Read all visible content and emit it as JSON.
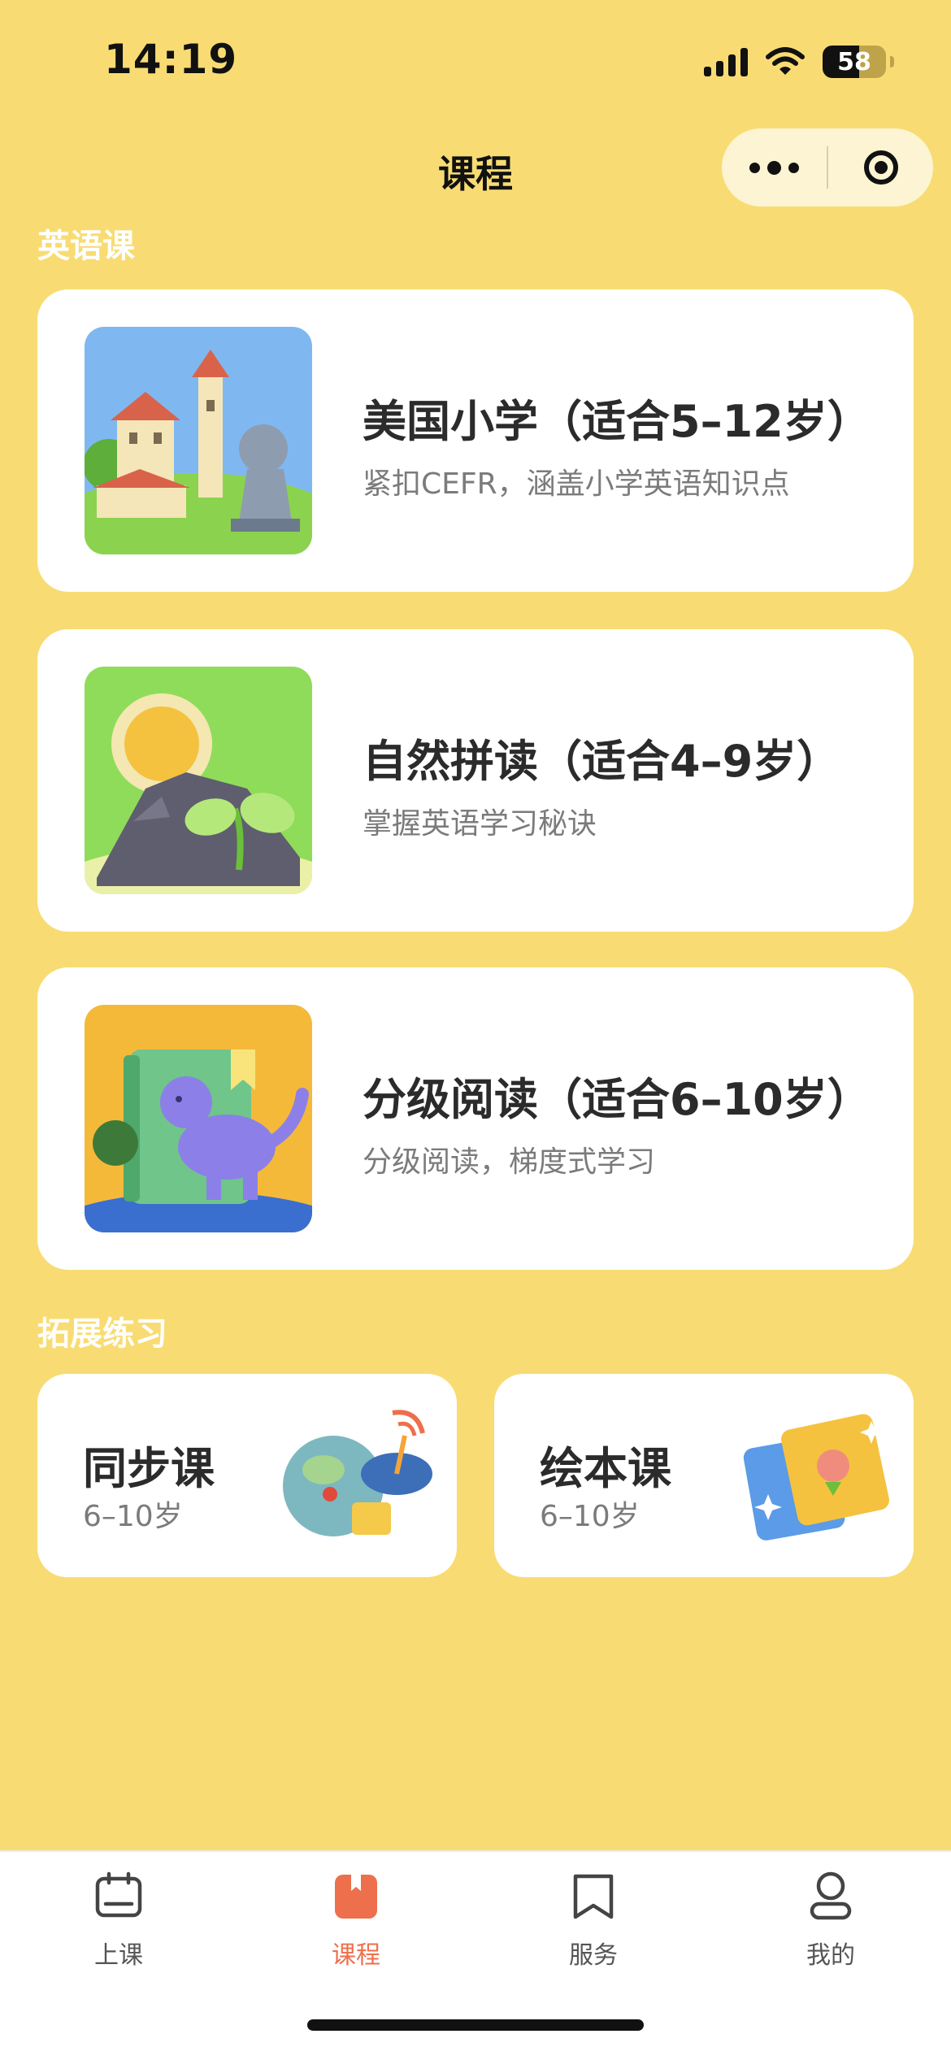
{
  "status": {
    "time": "14:19",
    "battery": "58"
  },
  "nav": {
    "title": "课程"
  },
  "sections": {
    "english": "英语课",
    "extension": "拓展练习"
  },
  "courses": [
    {
      "title": "美国小学（适合5–12岁）",
      "subtitle": "紧扣CEFR，涵盖小学英语知识点"
    },
    {
      "title": "自然拼读（适合4–9岁）",
      "subtitle": "掌握英语学习秘诀"
    },
    {
      "title": "分级阅读（适合6–10岁）",
      "subtitle": "分级阅读，梯度式学习"
    }
  ],
  "extension": [
    {
      "title": "同步课",
      "age": "6–10岁"
    },
    {
      "title": "绘本课",
      "age": "6–10岁"
    }
  ],
  "tabs": [
    {
      "label": "上课",
      "icon": "calendar-icon"
    },
    {
      "label": "课程",
      "icon": "book-icon",
      "active": true
    },
    {
      "label": "服务",
      "icon": "bookmark-icon"
    },
    {
      "label": "我的",
      "icon": "person-icon"
    }
  ],
  "colors": {
    "background": "#F8DC73",
    "accent": "#EE6F4C",
    "card": "#FFFFFF"
  }
}
